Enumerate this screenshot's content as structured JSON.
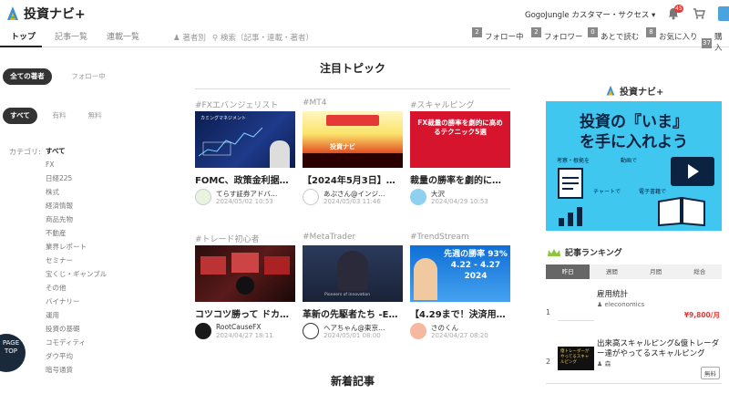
{
  "header": {
    "logo_text": "投資ナビ+",
    "account_label": "GogoJungle カスタマー・サクセス ▾",
    "notification_count": "45"
  },
  "nav": {
    "tabs": [
      "トップ",
      "記事一覧",
      "連載一覧"
    ],
    "author_field": "著者別",
    "search_field": "検索（記事・連載・著者）",
    "stats": [
      {
        "count": "2",
        "label": "フォロー中"
      },
      {
        "count": "2",
        "label": "フォロワー"
      },
      {
        "count": "0",
        "label": "あとで読む"
      },
      {
        "count": "8",
        "label": "お気に入り"
      },
      {
        "count": "37",
        "label": "購入"
      }
    ]
  },
  "sidebar": {
    "author_filter": [
      "全ての著者",
      "フォロー中"
    ],
    "price_filter": [
      "すべて",
      "有料",
      "無料"
    ],
    "category_label": "カテゴリ:",
    "categories": [
      "すべて",
      "FX",
      "日経225",
      "株式",
      "経済情報",
      "商品先物",
      "不動産",
      "業界レポート",
      "セミナー",
      "宝くじ・ギャンブル",
      "その他",
      "バイナリー",
      "運用",
      "投資の基礎",
      "コモディティ",
      "ダウ平均",
      "暗号通貨"
    ],
    "page_top": "PAGE TOP"
  },
  "main": {
    "featured_title": "注目トピック",
    "new_articles_title": "新着記事",
    "cards": [
      {
        "tag": "#FXエバンジェリスト",
        "title": "FOMC、政策金利据…",
        "author": "てらす証券アドバ…",
        "date": "2024/05/02 10:53",
        "thumb_text": "カミングマネジメント"
      },
      {
        "tag": "#MT4",
        "title": "【2024年5月3日】…",
        "author": "あぶさん@インジ…",
        "date": "2024/05/03 11:46",
        "thumb_text": "投資ナビ"
      },
      {
        "tag": "#スキャルピング",
        "title": "裁量の勝率を劇的に…",
        "author": "大沢",
        "date": "2024/04/29 10:53",
        "thumb_text": "FX裁量の勝率を劇的に高めるテクニック5選"
      },
      {
        "tag": "#トレード初心者",
        "title": "コツコツ勝って ドカ…",
        "author": "RootCauseFX",
        "date": "2024/04/27 18:11",
        "thumb_text": ""
      },
      {
        "tag": "#MetaTrader",
        "title": "革新の先駆者たち -E…",
        "author": "ヘアちゃん@東京…",
        "date": "2024/05/01 08:00",
        "thumb_text": "Pioneers of innovation"
      },
      {
        "tag": "#TrendStream",
        "title": "【4.29まで！決済用…",
        "author": "さのくん",
        "date": "2024/04/27 08:20",
        "thumb_text": "先週の勝率 93% 4.22 - 4.27 2024"
      }
    ]
  },
  "right": {
    "banner_logo": "投資ナビ+",
    "banner_line1": "投資の『いま』",
    "banner_line2": "を手に入れよう",
    "banner_caption1": "考察・根拠を",
    "banner_caption2": "動画で",
    "banner_caption3": "チャートで",
    "banner_caption4": "電子書籍で",
    "ranking_title": "記事ランキング",
    "ranking_tabs": [
      "昨日",
      "週間",
      "月間",
      "総合"
    ],
    "ranking": [
      {
        "num": "1",
        "title": "雇用統計",
        "author": "eleconomics",
        "price": "¥9,800/月",
        "thumb": ""
      },
      {
        "num": "2",
        "title": "出来高スキャルピング&億トレーダー達がやってるスキャルピング",
        "author": "森",
        "price": "無料",
        "thumb": "億トレーダーがやってるスキャルピング"
      }
    ]
  }
}
